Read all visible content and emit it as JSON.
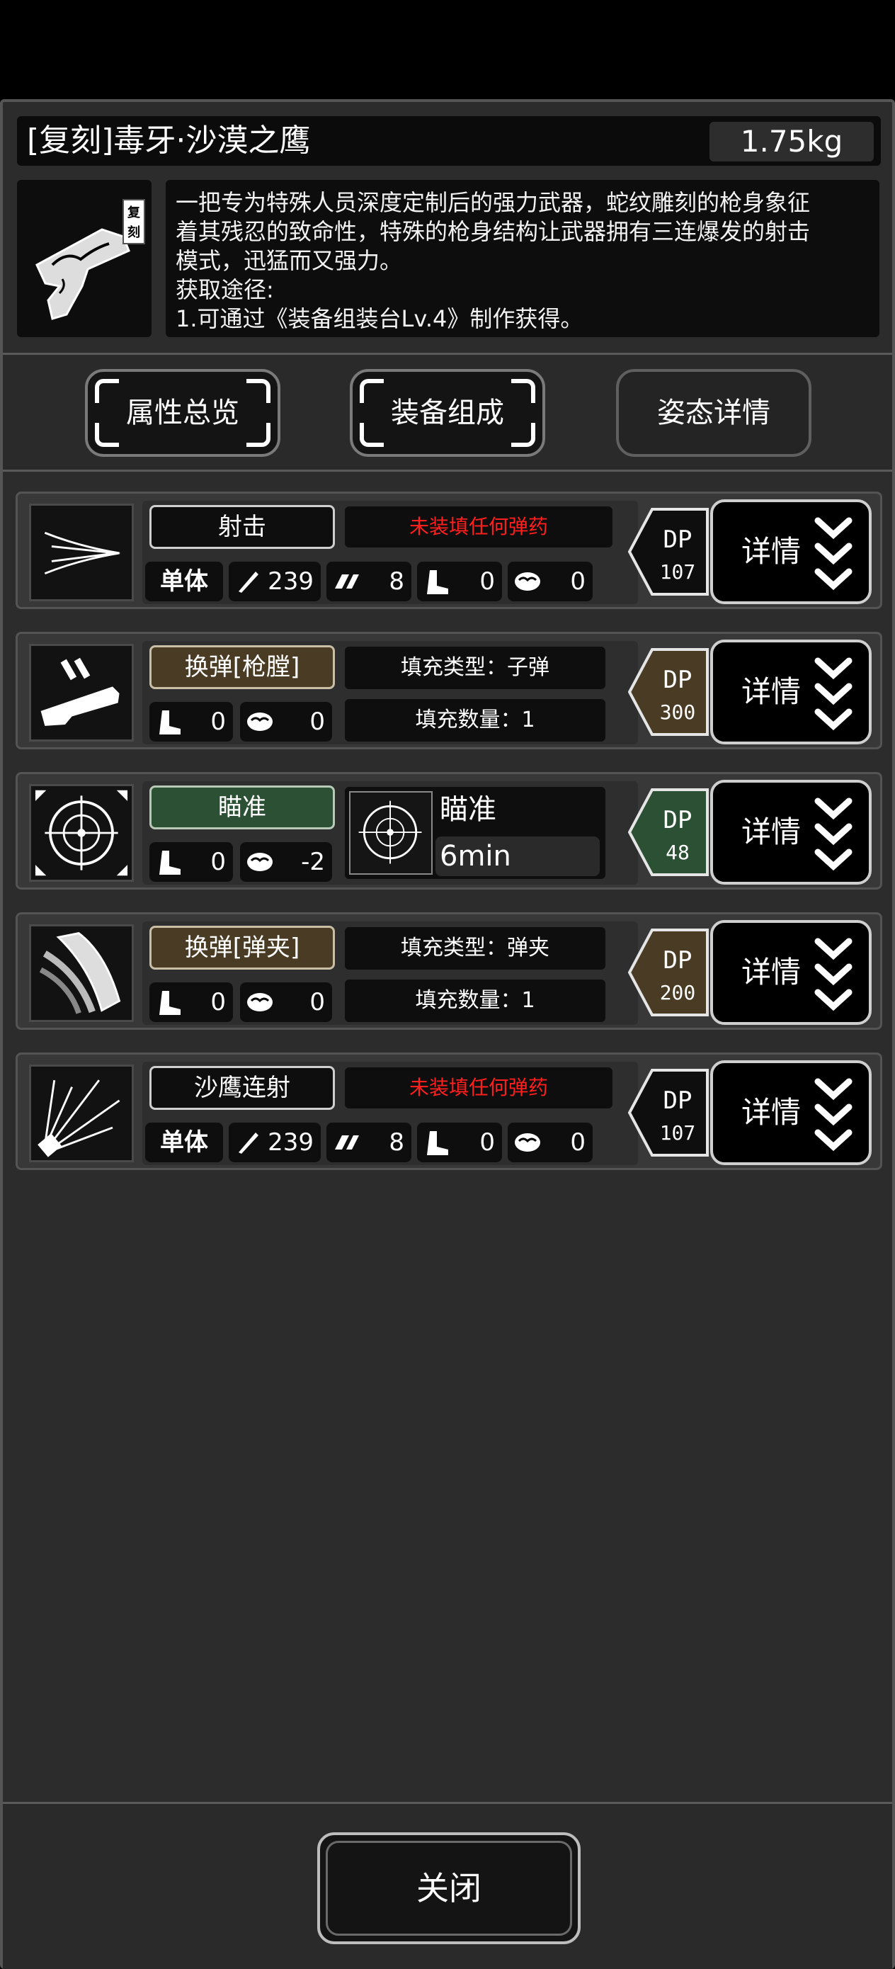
{
  "weapon": {
    "title": "[复刻]毒牙·沙漠之鹰",
    "weight": "1.75kg",
    "badge": "复刻",
    "description_lines": [
      "一把专为特殊人员深度定制后的强力武器，蛇纹雕刻的枪身象征",
      "着其残忍的致命性，特殊的枪身结构让武器拥有三连爆发的射击",
      "模式，迅猛而又强力。",
      "获取途径:",
      "1.可通过《装备组装台Lv.4》制作获得。"
    ]
  },
  "tabs": [
    {
      "label": "属性总览"
    },
    {
      "label": "装备组成"
    },
    {
      "label": "姿态详情"
    }
  ],
  "detail_label": "详情",
  "actions": [
    {
      "name": "射击",
      "icon": "shoot-icon",
      "label_style": "dark",
      "warning": "未装填任何弹药",
      "target": "单体",
      "attack": "239",
      "hits": "8",
      "move": "0",
      "mind": "0",
      "dp": "107",
      "dp_color": "#0e0e0e"
    },
    {
      "name": "换弹[枪膛]",
      "icon": "reload-chamber-icon",
      "label_style": "brown",
      "fill_type": "填充类型：子弹",
      "fill_count": "填充数量：1",
      "move": "0",
      "mind": "0",
      "dp": "300",
      "dp_color": "#4a3c24"
    },
    {
      "name": "瞄准",
      "icon": "crosshair-icon",
      "label_style": "green",
      "aim_name": "瞄准",
      "aim_time": "6min",
      "move": "0",
      "mind": "-2",
      "dp": "48",
      "dp_color": "#2b5033"
    },
    {
      "name": "换弹[弹夹]",
      "icon": "reload-magazine-icon",
      "label_style": "brown",
      "fill_type": "填充类型：弹夹",
      "fill_count": "填充数量：1",
      "move": "0",
      "mind": "0",
      "dp": "200",
      "dp_color": "#4a3c24"
    },
    {
      "name": "沙鹰连射",
      "icon": "burst-fire-icon",
      "label_style": "dark",
      "warning": "未装填任何弹药",
      "target": "单体",
      "attack": "239",
      "hits": "8",
      "move": "0",
      "mind": "0",
      "dp": "107",
      "dp_color": "#0e0e0e"
    }
  ],
  "close_label": "关闭",
  "colors": {
    "warning": "#ff1f1f",
    "panel": "#2c2c2c",
    "card": "#383838"
  }
}
